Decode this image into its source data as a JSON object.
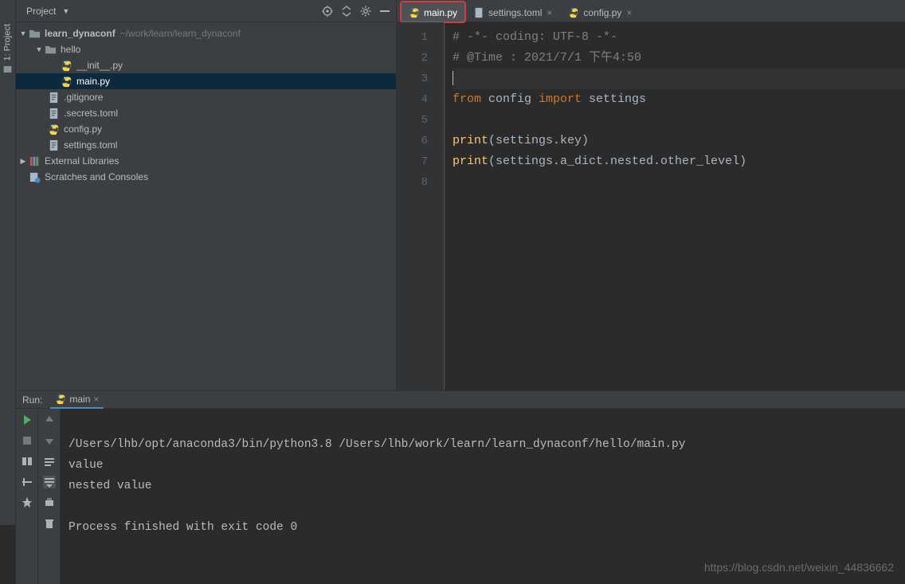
{
  "sidebar": {
    "title": "Project",
    "tree": {
      "root": {
        "name": "learn_dynaconf",
        "path": "~/work/learn/learn_dynaconf"
      },
      "hello": "hello",
      "init": "__init__.py",
      "main": "main.py",
      "gitignore": ".gitignore",
      "secrets": ".secrets.toml",
      "config": "config.py",
      "settings": "settings.toml",
      "ext_lib": "External Libraries",
      "scratches": "Scratches and Consoles"
    }
  },
  "tabs": {
    "main": "main.py",
    "settings": "settings.toml",
    "config": "config.py"
  },
  "code": {
    "l1_comment": "# -*- coding: UTF-8 -*-",
    "l2_comment": "# @Time : 2021/7/1 下午4:50",
    "l4_from": "from",
    "l4_mod": " config ",
    "l4_import": "import",
    "l4_name": " settings",
    "l6_print": "print",
    "l6_rest": "(settings.key)",
    "l7_print": "print",
    "l7_rest": "(settings.a_dict.nested.other_level)",
    "line_numbers": [
      "1",
      "2",
      "3",
      "4",
      "5",
      "6",
      "7",
      "8"
    ]
  },
  "run": {
    "label": "Run:",
    "config_name": "main",
    "lines": {
      "cmd": "/Users/lhb/opt/anaconda3/bin/python3.8 /Users/lhb/work/learn/learn_dynaconf/hello/main.py",
      "out1": "value",
      "out2": "nested value",
      "blank": "",
      "exit": "Process finished with exit code 0"
    }
  },
  "watermark": "https://blog.csdn.net/weixin_44836662",
  "tool_strip": {
    "project": "1: Project"
  }
}
